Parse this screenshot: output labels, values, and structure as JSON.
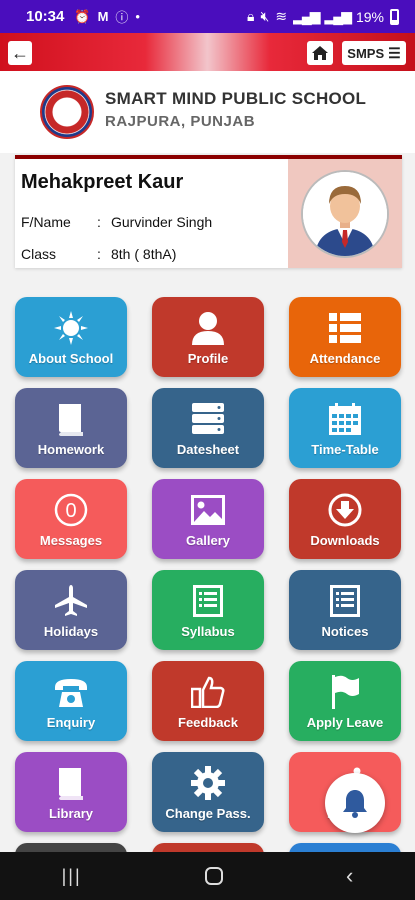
{
  "status_bar": {
    "time": "10:34",
    "battery": "19%"
  },
  "app_bar": {
    "menu_label": "SMPS"
  },
  "school": {
    "name": "SMART MIND PUBLIC SCHOOL",
    "location": "RAJPURA, PUNJAB"
  },
  "student": {
    "name": "Mehakpreet Kaur",
    "father_label": "F/Name",
    "father_value": "Gurvinder Singh",
    "class_label": "Class",
    "class_value": "8th ( 8thA)",
    "colon": ":"
  },
  "tiles": [
    {
      "label": "About School",
      "icon": "sun-icon",
      "color": "#2b9fd3"
    },
    {
      "label": "Profile",
      "icon": "person-icon",
      "color": "#c0392b"
    },
    {
      "label": "Attendance",
      "icon": "list-icon",
      "color": "#e8650a"
    },
    {
      "label": "Homework",
      "icon": "book-icon",
      "color": "#5b6494"
    },
    {
      "label": "Datesheet",
      "icon": "server-icon",
      "color": "#36648b"
    },
    {
      "label": "Time-Table",
      "icon": "calendar-icon",
      "color": "#2b9fd3"
    },
    {
      "label": "Messages",
      "icon": "zero-badge-icon",
      "color": "#f55b5b"
    },
    {
      "label": "Gallery",
      "icon": "image-icon",
      "color": "#9b4dc4"
    },
    {
      "label": "Downloads",
      "icon": "download-icon",
      "color": "#c0392b"
    },
    {
      "label": "Holidays",
      "icon": "airplane-icon",
      "color": "#5b6494"
    },
    {
      "label": "Syllabus",
      "icon": "document-list-icon",
      "color": "#27ae60"
    },
    {
      "label": "Notices",
      "icon": "document-list-icon",
      "color": "#36648b"
    },
    {
      "label": "Enquiry",
      "icon": "phone-icon",
      "color": "#2b9fd3"
    },
    {
      "label": "Feedback",
      "icon": "thumbs-up-icon",
      "color": "#c0392b"
    },
    {
      "label": "Apply Leave",
      "icon": "flag-icon",
      "color": "#27ae60"
    },
    {
      "label": "Library",
      "icon": "book-icon",
      "color": "#9b4dc4"
    },
    {
      "label": "Change Pass.",
      "icon": "gear-icon",
      "color": "#36648b"
    },
    {
      "label": "Rou...",
      "icon": "route-icon",
      "color": "#f55b5b"
    }
  ],
  "partial_row_colors": [
    "#444444",
    "#c0392b",
    "#2b7fd3"
  ]
}
